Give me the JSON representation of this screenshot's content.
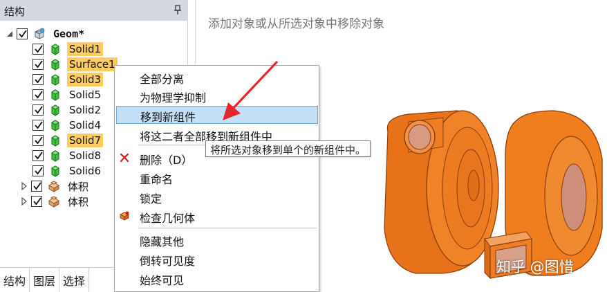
{
  "panel": {
    "title": "结构",
    "pin": "pin-icon"
  },
  "tree": {
    "root": {
      "label": "Geom*",
      "icon": "geometry-icon"
    },
    "items": [
      {
        "label": "Solid1",
        "highlighted": true
      },
      {
        "label": "Surface1",
        "highlighted": true
      },
      {
        "label": "Solid3",
        "highlighted": true
      },
      {
        "label": "Solid5",
        "highlighted": false
      },
      {
        "label": "Solid2",
        "highlighted": false
      },
      {
        "label": "Solid4",
        "highlighted": false
      },
      {
        "label": "Solid7",
        "highlighted": true
      },
      {
        "label": "Solid8",
        "highlighted": false
      },
      {
        "label": "Solid6",
        "highlighted": false
      }
    ],
    "groups": [
      {
        "label": "体积"
      },
      {
        "label": "体积"
      }
    ]
  },
  "tabs": [
    {
      "label": "结构",
      "active": true
    },
    {
      "label": "图层",
      "active": false
    },
    {
      "label": "选择",
      "active": false
    }
  ],
  "viewport": {
    "hint": "添加对象或从所选对象中移除对象"
  },
  "menu": {
    "items": [
      {
        "label": "全部分离"
      },
      {
        "label": "为物理学抑制"
      },
      {
        "label": "移到新组件",
        "selected": true
      },
      {
        "label": "将这二者全部移到新组件中"
      },
      {
        "label": "删除（D）",
        "icon": "delete-icon"
      },
      {
        "label": "重命名"
      },
      {
        "label": "锁定"
      },
      {
        "label": "检查几何体",
        "icon": "check-geometry-icon"
      },
      {
        "label": "隐藏其他"
      },
      {
        "label": "倒转可见度"
      },
      {
        "label": "始终可见"
      }
    ]
  },
  "tooltip": "将所选对象移到单个的新组件中。",
  "watermark": "知乎 @图惜",
  "colors": {
    "highlight": "#ffcc66",
    "selected_menu": "#c5dff7",
    "model_orange": "#f07d1e",
    "arrow": "#e8262a"
  }
}
